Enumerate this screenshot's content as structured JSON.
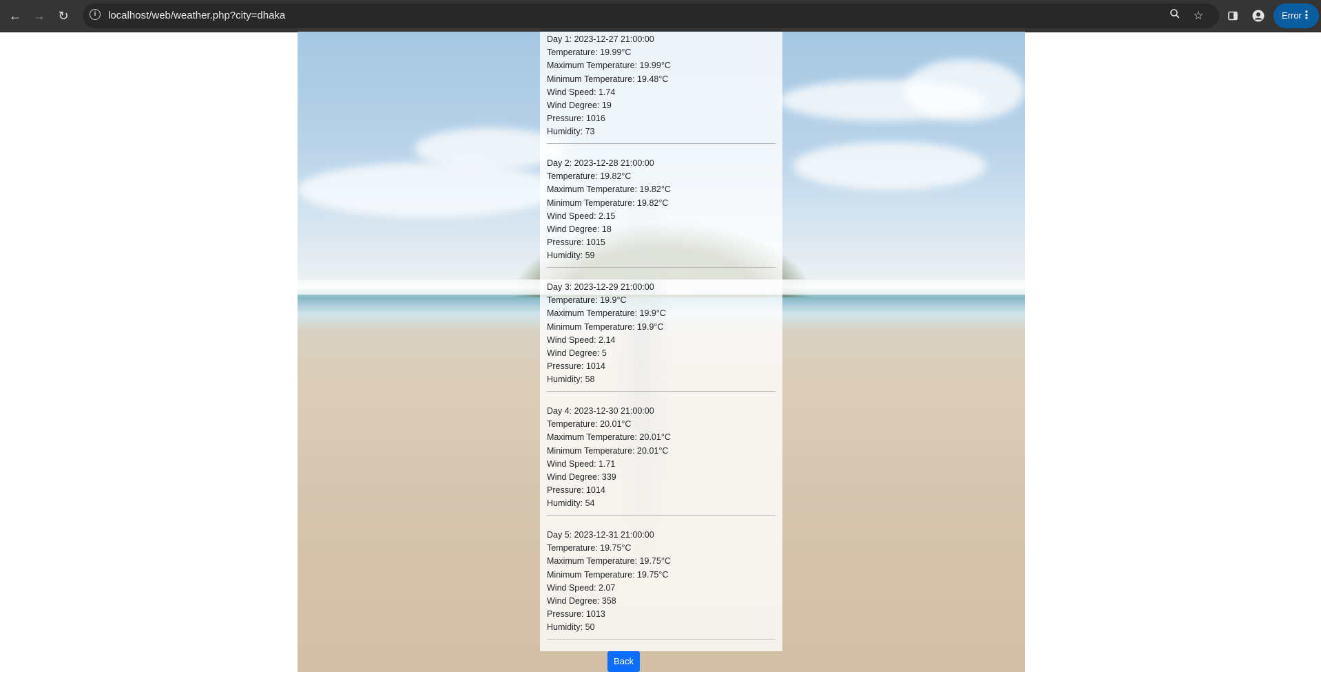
{
  "browser": {
    "url": "localhost/web/weather.php?city=dhaka",
    "profile_status": "Error",
    "icons": {
      "back": "arrow-left-icon",
      "forward": "arrow-right-icon",
      "reload": "reload-icon",
      "site_info": "info-icon",
      "zoom": "zoom-icon",
      "bookmark": "star-icon",
      "side_panel": "side-panel-icon",
      "profile": "person-icon",
      "menu": "kebab-menu-icon"
    }
  },
  "forecast": [
    {
      "day": "Day 1: 2023-12-27 21:00:00",
      "temperature": "Temperature: 19.99°C",
      "max_temperature": "Maximum Temperature: 19.99°C",
      "min_temperature": "Minimum Temperature: 19.48°C",
      "wind_speed": "Wind Speed: 1.74",
      "wind_degree": "Wind Degree: 19",
      "pressure": "Pressure: 1016",
      "humidity": "Humidity: 73"
    },
    {
      "day": "Day 2: 2023-12-28 21:00:00",
      "temperature": "Temperature: 19.82°C",
      "max_temperature": "Maximum Temperature: 19.82°C",
      "min_temperature": "Minimum Temperature: 19.82°C",
      "wind_speed": "Wind Speed: 2.15",
      "wind_degree": "Wind Degree: 18",
      "pressure": "Pressure: 1015",
      "humidity": "Humidity: 59"
    },
    {
      "day": "Day 3: 2023-12-29 21:00:00",
      "temperature": "Temperature: 19.9°C",
      "max_temperature": "Maximum Temperature: 19.9°C",
      "min_temperature": "Minimum Temperature: 19.9°C",
      "wind_speed": "Wind Speed: 2.14",
      "wind_degree": "Wind Degree: 5",
      "pressure": "Pressure: 1014",
      "humidity": "Humidity: 58"
    },
    {
      "day": "Day 4: 2023-12-30 21:00:00",
      "temperature": "Temperature: 20.01°C",
      "max_temperature": "Maximum Temperature: 20.01°C",
      "min_temperature": "Minimum Temperature: 20.01°C",
      "wind_speed": "Wind Speed: 1.71",
      "wind_degree": "Wind Degree: 339",
      "pressure": "Pressure: 1014",
      "humidity": "Humidity: 54"
    },
    {
      "day": "Day 5: 2023-12-31 21:00:00",
      "temperature": "Temperature: 19.75°C",
      "max_temperature": "Maximum Temperature: 19.75°C",
      "min_temperature": "Minimum Temperature: 19.75°C",
      "wind_speed": "Wind Speed: 2.07",
      "wind_degree": "Wind Degree: 358",
      "pressure": "Pressure: 1013",
      "humidity": "Humidity: 50"
    }
  ],
  "back_button": {
    "label": "Back",
    "color": "#0d6efd"
  }
}
